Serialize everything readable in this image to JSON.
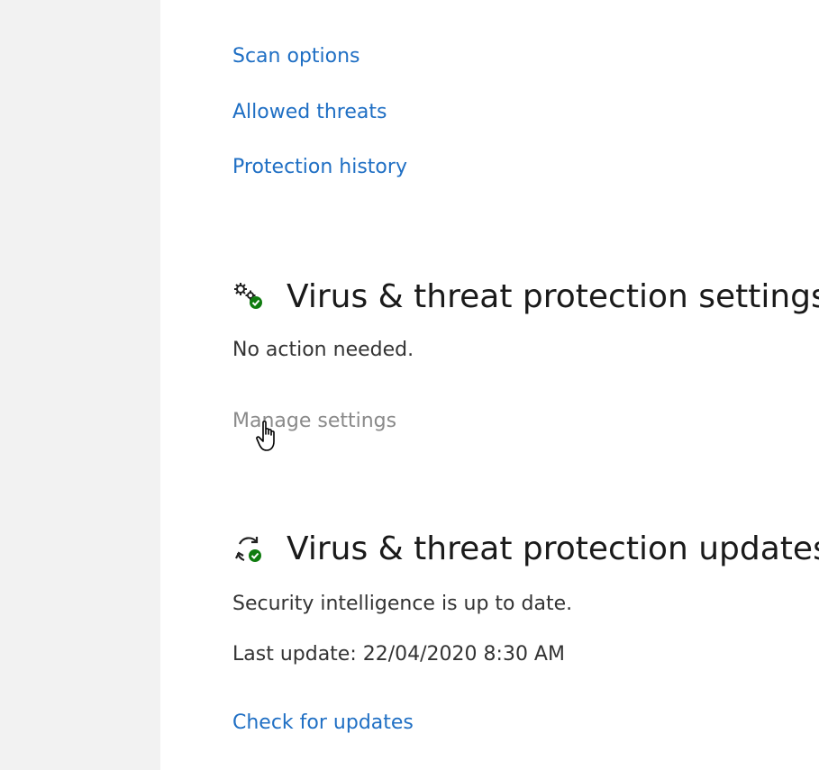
{
  "links": {
    "scan_options": "Scan options",
    "allowed_threats": "Allowed threats",
    "protection_history": "Protection history"
  },
  "settings_section": {
    "icon": "settings-gears-check-icon",
    "title": "Virus & threat protection settings",
    "status": "No action needed.",
    "manage_link": "Manage settings"
  },
  "updates_section": {
    "icon": "refresh-check-icon",
    "title": "Virus & threat protection updates",
    "status": "Security intelligence is up to date.",
    "last_update": "Last update: 22/04/2020 8:30 AM",
    "check_link": "Check for updates"
  },
  "colors": {
    "link": "#1f6fc4",
    "check_green": "#107c10",
    "sidebar_bg": "#f2f2f2"
  },
  "cursor": {
    "icon": "hand-pointer-cursor-icon"
  }
}
